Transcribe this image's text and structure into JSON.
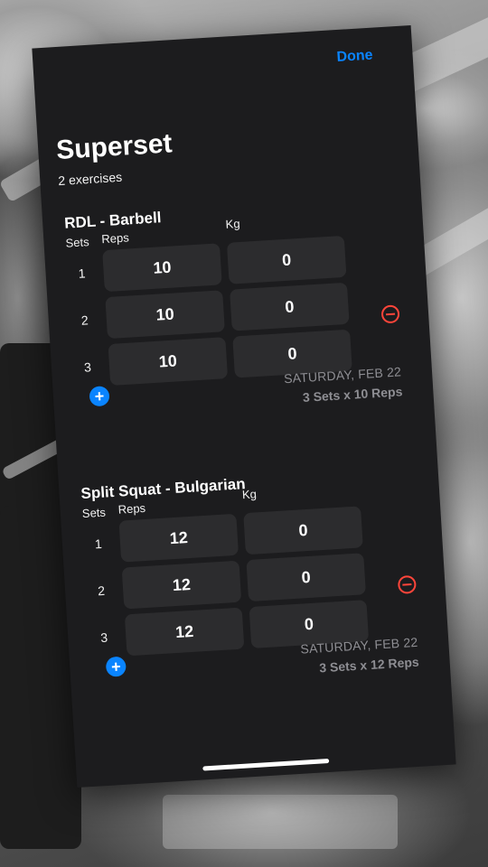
{
  "header": {
    "done_label": "Done",
    "title": "Superset",
    "subtitle": "2 exercises"
  },
  "columns": {
    "sets": "Sets",
    "reps": "Reps",
    "kg": "Kg"
  },
  "exercises": [
    {
      "name": "RDL - Barbell",
      "sets": [
        {
          "num": "1",
          "reps": "10",
          "kg": "0"
        },
        {
          "num": "2",
          "reps": "10",
          "kg": "0"
        },
        {
          "num": "3",
          "reps": "10",
          "kg": "0"
        }
      ],
      "date": "SATURDAY, FEB 22",
      "summary": "3 Sets x 10 Reps"
    },
    {
      "name": "Split Squat - Bulgarian",
      "sets": [
        {
          "num": "1",
          "reps": "12",
          "kg": "0"
        },
        {
          "num": "2",
          "reps": "12",
          "kg": "0"
        },
        {
          "num": "3",
          "reps": "12",
          "kg": "0"
        }
      ],
      "date": "SATURDAY, FEB 22",
      "summary": "3 Sets x 12 Reps"
    }
  ],
  "icons": {
    "add": "plus-circle-icon",
    "remove": "minus-circle-icon"
  },
  "colors": {
    "accent": "#0a84ff",
    "destructive": "#ff453a",
    "card_background": "#1c1c1e",
    "cell_background": "#2c2c2e"
  }
}
